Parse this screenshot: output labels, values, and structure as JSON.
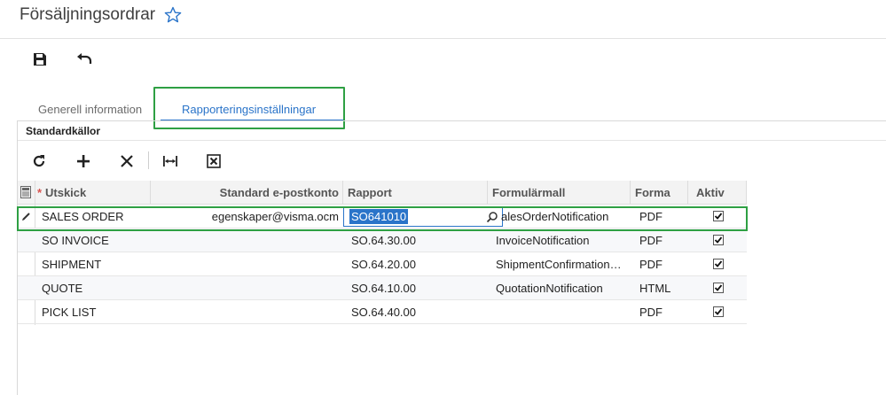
{
  "page": {
    "title": "Försäljningsordrar"
  },
  "tabs": [
    {
      "label": "Generell information"
    },
    {
      "label": "Rapporteringsinställningar"
    }
  ],
  "section": {
    "caption": "Standardkällor"
  },
  "grid": {
    "columns": [
      "Utskick",
      "Standard e-postkonto",
      "Rapport",
      "Formulärmall",
      "Forma",
      "Aktiv"
    ],
    "required_marker": "*",
    "rows": [
      {
        "utskick": "SALES ORDER",
        "email": "egenskaper@visma.ocm",
        "rapport": "SO641010",
        "formular": "alesOrderNotification",
        "format": "PDF",
        "aktiv": true
      },
      {
        "utskick": "SO INVOICE",
        "email": "",
        "rapport": "SO.64.30.00",
        "formular": "InvoiceNotification",
        "format": "PDF",
        "aktiv": true
      },
      {
        "utskick": "SHIPMENT",
        "email": "",
        "rapport": "SO.64.20.00",
        "formular": "ShipmentConfirmation…",
        "format": "PDF",
        "aktiv": true
      },
      {
        "utskick": "QUOTE",
        "email": "",
        "rapport": "SO.64.10.00",
        "formular": "QuotationNotification",
        "format": "HTML",
        "aktiv": true
      },
      {
        "utskick": "PICK LIST",
        "email": "",
        "rapport": "SO.64.40.00",
        "formular": "",
        "format": "PDF",
        "aktiv": true
      }
    ]
  },
  "colors": {
    "accent": "#2a74c9",
    "highlight_border": "#2ea043"
  }
}
